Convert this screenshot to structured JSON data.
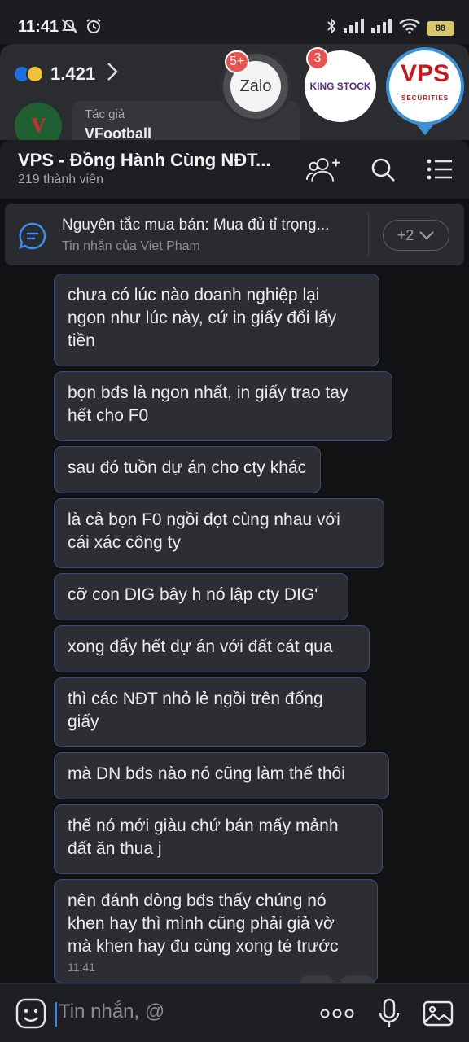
{
  "status_bar": {
    "time": "11:41",
    "battery": "88",
    "icons_left": [
      "mute-icon",
      "alarm-icon"
    ],
    "icons_right": [
      "bluetooth-icon",
      "signal-icon",
      "signal-icon",
      "wifi-icon",
      "battery-icon"
    ]
  },
  "background_post": {
    "reaction_count": "1.421",
    "author_role": "Tác giả",
    "author_name": "VFootball",
    "avatar_text": "V"
  },
  "chat_heads": [
    {
      "name": "Zalo",
      "badge": "5+"
    },
    {
      "name": "KING STOCK",
      "badge": "3"
    },
    {
      "name": "VPS",
      "sub": "SECURITIES"
    }
  ],
  "header": {
    "title": "VPS - Đồng Hành Cùng NĐT...",
    "members": "219 thành viên"
  },
  "pinned": {
    "title": "Nguyên tắc mua bán: Mua đủ tỉ trọng...",
    "subtitle": "Tin nhắn của Viet Pham",
    "more": "+2"
  },
  "messages": [
    {
      "text": "chưa có lúc nào doanh nghiệp lại\nngon như lúc này, cứ in giấy đổi lấy\ntiền"
    },
    {
      "text": "bọn bđs là ngon nhất, in giấy trao tay\nhết cho F0"
    },
    {
      "text": "sau đó tuồn dự án cho cty khác"
    },
    {
      "text": "là cả bọn F0 ngồi đọt cùng nhau với\ncái xác công ty"
    },
    {
      "text": "cỡ con DIG bây h nó lập cty DIG'"
    },
    {
      "text": "xong đẩy hết dự án với đất cát qua"
    },
    {
      "text": "thì các NĐT nhỏ lẻ ngồi trên đống\ngiấy"
    },
    {
      "text": "mà DN bđs nào nó cũng làm thế thôi"
    },
    {
      "text": "thế nó mới giàu chứ bán mấy mảnh\nđất ăn thua j"
    },
    {
      "text": "nên đánh dòng bđs thấy chúng nó\nkhen hay thì mình cũng phải giả vờ\nmà khen hay đu cùng xong té trước",
      "time": "11:41"
    }
  ],
  "input": {
    "placeholder": "Tin nhắn, @"
  }
}
